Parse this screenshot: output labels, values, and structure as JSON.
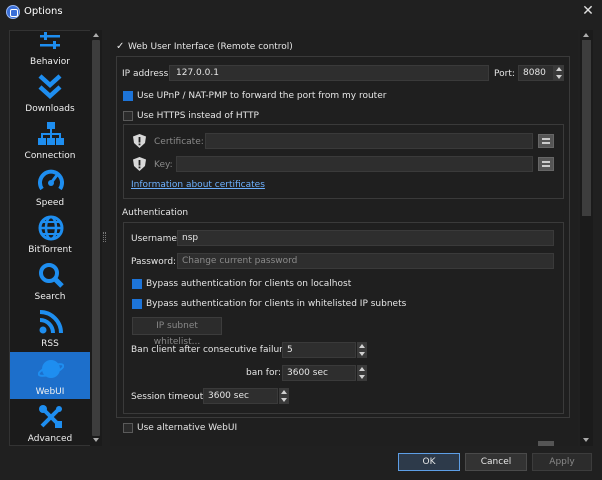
{
  "window": {
    "title": "Options",
    "close_glyph": "✕"
  },
  "sidebar": {
    "items": [
      {
        "label": "Behavior",
        "icon": "sliders-icon"
      },
      {
        "label": "Downloads",
        "icon": "double-chevron-down-icon"
      },
      {
        "label": "Connection",
        "icon": "network-icon"
      },
      {
        "label": "Speed",
        "icon": "speedometer-icon"
      },
      {
        "label": "BitTorrent",
        "icon": "globe-icon"
      },
      {
        "label": "Search",
        "icon": "magnifier-icon"
      },
      {
        "label": "RSS",
        "icon": "rss-icon"
      },
      {
        "label": "WebUI",
        "icon": "planet-icon",
        "selected": true
      },
      {
        "label": "Advanced",
        "icon": "wrench-screwdriver-icon"
      }
    ]
  },
  "webui": {
    "enable_label": "Web User Interface (Remote control)",
    "ip_label": "IP address:",
    "ip_value": "127.0.0.1",
    "port_label": "Port:",
    "port_value": "8080",
    "upnp_label": "Use UPnP / NAT-PMP to forward the port from my router",
    "https_label": "Use HTTPS instead of HTTP",
    "cert_label": "Certificate:",
    "key_label": "Key:",
    "cert_info_link": "Information about certificates",
    "auth_title": "Authentication",
    "username_label": "Username:",
    "username_value": "nsp",
    "password_label": "Password:",
    "password_placeholder": "Change current password",
    "bypass_localhost_label": "Bypass authentication for clients on localhost",
    "bypass_whitelist_label": "Bypass authentication for clients in whitelisted IP subnets",
    "subnet_whitelist_button": "IP subnet whitelist...",
    "ban_failures_label": "Ban client after consecutive failures:",
    "ban_failures_value": "5",
    "ban_for_label": "ban for:",
    "ban_for_value": "3600 sec",
    "session_timeout_label": "Session timeout:",
    "session_timeout_value": "3600 sec",
    "alt_webui_label": "Use alternative WebUI"
  },
  "buttons": {
    "ok": "OK",
    "cancel": "Cancel",
    "apply": "Apply"
  },
  "colors": {
    "accent": "#1d6fcb",
    "link": "#6db1ff",
    "background": "#202020"
  }
}
